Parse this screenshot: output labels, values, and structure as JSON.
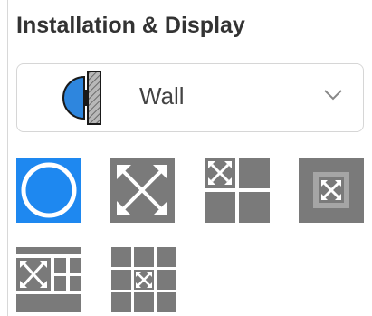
{
  "section": {
    "title": "Installation & Display"
  },
  "installation": {
    "selected_value": "Wall",
    "icon": "wall-mount-icon",
    "dropdown_icon": "chevron-down-icon"
  },
  "display_modes": [
    {
      "name": "fisheye",
      "icon": "circle-fisheye-icon",
      "selected": true
    },
    {
      "name": "panorama-expand",
      "icon": "expand-arrows-icon",
      "selected": false
    },
    {
      "name": "1+3",
      "icon": "quad-view-icon",
      "selected": false
    },
    {
      "name": "1+8",
      "icon": "center-view-icon",
      "selected": false
    },
    {
      "name": "1+5",
      "icon": "multi-view-icon",
      "selected": false
    },
    {
      "name": "3x3",
      "icon": "grid-view-icon",
      "selected": false
    }
  ],
  "colors": {
    "accent": "#1e88f0",
    "icon_gray": "#7a7a7a",
    "icon_light": "#a5a5a5",
    "text": "#333333"
  }
}
